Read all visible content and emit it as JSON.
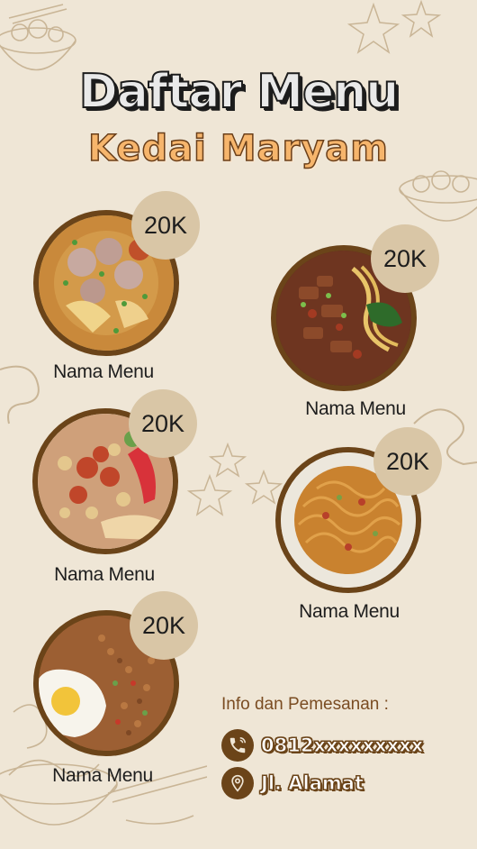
{
  "header": {
    "title": "Daftar Menu",
    "subtitle": "Kedai Maryam"
  },
  "menu": [
    {
      "price": "20K",
      "name": "Nama Menu",
      "dish": "bakso-dumpling-soup"
    },
    {
      "price": "20K",
      "name": "Nama Menu",
      "dish": "fried-noodles-greens"
    },
    {
      "price": "20K",
      "name": "Nama Menu",
      "dish": "meatball-skewers-platter"
    },
    {
      "price": "20K",
      "name": "Nama Menu",
      "dish": "fried-instant-noodles"
    },
    {
      "price": "20K",
      "name": "Nama Menu",
      "dish": "fried-rice-egg"
    }
  ],
  "info": {
    "title": "Info dan Pemesanan :",
    "phone": "0812xxxxxxxxx",
    "address": "Jl. Alamat"
  },
  "icons": {
    "phone": "phone-icon",
    "address": "location-pin-icon"
  },
  "colors": {
    "background": "#efe6d6",
    "brown": "#6b4419",
    "price_badge": "#d9c6a6",
    "subtitle": "#f6b56c"
  }
}
